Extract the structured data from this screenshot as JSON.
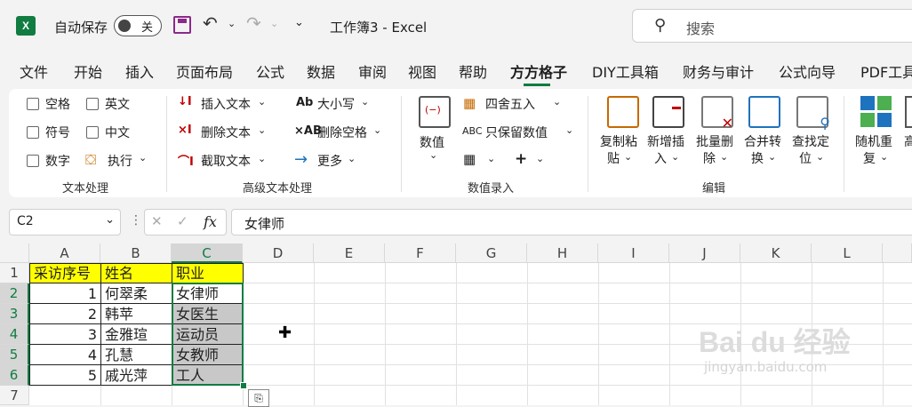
{
  "titlebar": {
    "logo": "X",
    "autosave_label": "自动保存",
    "autosave_state": "关",
    "doc_title": "工作簿3  -  Excel",
    "search_placeholder": "搜索"
  },
  "menu": {
    "tabs": [
      "文件",
      "开始",
      "插入",
      "页面布局",
      "公式",
      "数据",
      "审阅",
      "视图",
      "帮助",
      "方方格子",
      "DIY工具箱",
      "财务与审计",
      "公式向导",
      "PDF工具"
    ],
    "active_tab": "方方格子"
  },
  "ribbon": {
    "text_processing": {
      "items": [
        "空格",
        "英文",
        "符号",
        "中文",
        "数字"
      ],
      "execute": "执行",
      "group_label": "文本处理"
    },
    "advanced_text": {
      "insert": "插入文本",
      "delete": "删除文本",
      "extract": "截取文本",
      "case": "大小写",
      "del_space": "删除空格",
      "more": "更多",
      "group_label": "高级文本处理"
    },
    "numeric_entry": {
      "value_big": "数值",
      "round": "四舍五入",
      "keep_value": "只保留数值",
      "plus": "+",
      "group_label": "数值录入"
    },
    "edit": {
      "copy_paste": [
        "复制粘",
        "贴"
      ],
      "add_insert": [
        "新增插",
        "入"
      ],
      "batch_delete": [
        "批量删",
        "除"
      ],
      "merge_convert": [
        "合并转",
        "换"
      ],
      "find_locate": [
        "查找定",
        "位"
      ],
      "group_label": "编辑"
    },
    "random": {
      "random_repeat": [
        "随机重",
        "复"
      ],
      "next": [
        "高",
        ""
      ]
    }
  },
  "formula_bar": {
    "name_box": "C2",
    "fx": "fx",
    "cancel": "✕",
    "enter": "✓",
    "content": "女律师"
  },
  "sheet": {
    "columns": [
      "A",
      "B",
      "C",
      "D",
      "E",
      "F",
      "G",
      "H",
      "I",
      "J",
      "K",
      "L"
    ],
    "selected_column": "C",
    "rows": [
      "1",
      "2",
      "3",
      "4",
      "5",
      "6",
      "7"
    ],
    "header": [
      "采访序号",
      "姓名",
      "职业"
    ],
    "data": [
      {
        "id": 1,
        "name": "何翠柔",
        "job": "女律师"
      },
      {
        "id": 2,
        "name": "韩苹",
        "job": "女医生"
      },
      {
        "id": 3,
        "name": "金雅瑄",
        "job": "运动员"
      },
      {
        "id": 4,
        "name": "孔慧",
        "job": "女教师"
      },
      {
        "id": 5,
        "name": "戚光萍",
        "job": "工人"
      }
    ]
  },
  "colors": {
    "accent": "#107c41",
    "header_fill": "#ffff00",
    "selection_fill": "#c8c8c8"
  },
  "watermark": {
    "brand": "Bai du 经验",
    "url": "jingyan.baidu.com"
  }
}
